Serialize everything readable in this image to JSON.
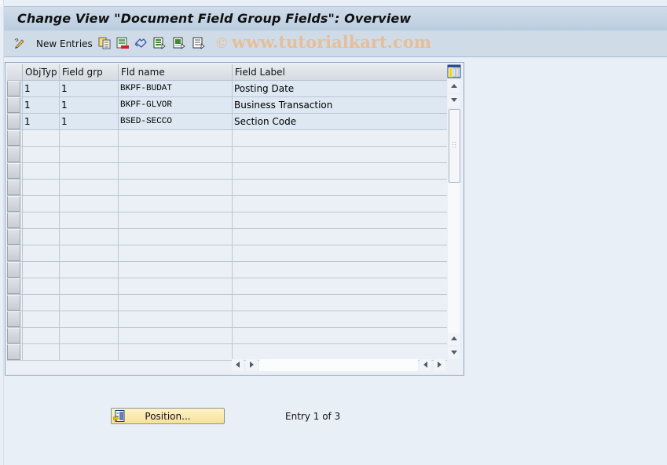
{
  "window": {
    "title": "Change View \"Document Field Group Fields\": Overview"
  },
  "toolbar": {
    "new_entries_label": "New Entries",
    "icons": [
      "edit-pencil-icon",
      "copy-icon",
      "delete-icon",
      "undo-icon",
      "select-all-icon",
      "select-block-icon",
      "deselect-all-icon"
    ],
    "watermark": "www.tutorialkart.com",
    "watermark_symbol": "©"
  },
  "table": {
    "columns": [
      "ObjTyp",
      "Field grp",
      "Fld name",
      "Field Label"
    ],
    "rows": [
      {
        "objtyp": "1",
        "field_grp": "1",
        "fld_name": "BKPF-BUDAT",
        "field_label": "Posting Date"
      },
      {
        "objtyp": "1",
        "field_grp": "1",
        "fld_name": "BKPF-GLVOR",
        "field_label": "Business Transaction"
      },
      {
        "objtyp": "1",
        "field_grp": "1",
        "fld_name": "BSED-SECCO",
        "field_label": "Section Code"
      }
    ],
    "visible_row_count": 17
  },
  "footer": {
    "position_button_label": "Position...",
    "entry_status": "Entry 1 of 3"
  },
  "colors": {
    "title_bar": "#c3d4e6",
    "toolbar": "#cfdce8",
    "background": "#e9eff7",
    "filled_row": "#dde8f3",
    "position_button": "#f9e8a9",
    "watermark": "#ebb98a"
  }
}
